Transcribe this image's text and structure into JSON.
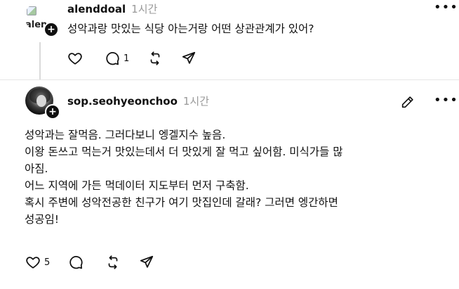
{
  "reply1": {
    "username": "alenddoal",
    "time": "1시간",
    "avatar_alt": "alen",
    "text": "성악과랑 맛있는 식당 아는거랑 어떤 상관관계가 있어?",
    "actions": {
      "like_count": "",
      "comment_count": "1",
      "repost_count": "",
      "share_count": ""
    }
  },
  "reply2": {
    "username": "sop.seohyeonchoo",
    "time": "1시간",
    "lines": [
      "성악과는 잘먹음. 그러다보니 엥겔지수 높음.",
      "이왕 돈쓰고 먹는거 맛있는데서 더 맛있게 잘 먹고 싶어함. 미식가들 많",
      "아짐.",
      "어느 지역에 가든 먹데이터 지도부터 먼저 구축함.",
      "혹시 주변에 성악전공한 친구가 여기 맛집인데 갈래? 그러면 엥간하면",
      "성공임!"
    ],
    "actions": {
      "like_count": "5",
      "comment_count": "",
      "repost_count": "",
      "share_count": ""
    }
  },
  "icons": {
    "more": "more-horizontal-icon",
    "edit": "pencil-icon",
    "like": "heart-icon",
    "comment": "comment-bubble-icon",
    "repost": "repost-icon",
    "share": "send-icon",
    "follow": "plus-icon"
  },
  "colors": {
    "text": "#101010",
    "muted": "#999999",
    "divider": "#e6e6e6",
    "thread_line": "#dadada"
  }
}
